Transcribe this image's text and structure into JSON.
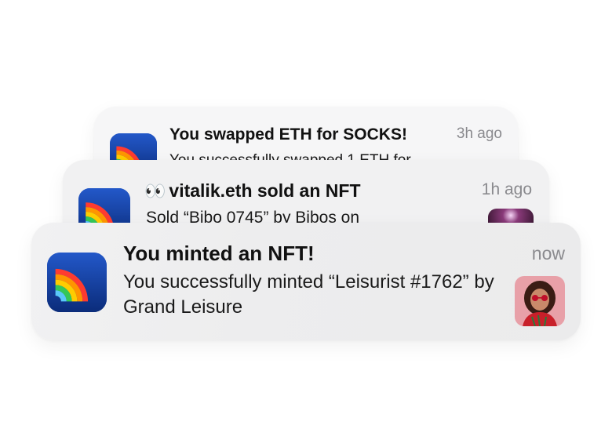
{
  "notifications": [
    {
      "title": "You swapped ETH for SOCKS!",
      "body": "You successfully swapped 1 ETH for",
      "time": "3h ago"
    },
    {
      "title_prefix_emoji": "👀",
      "title": "vitalik.eth sold an NFT",
      "body": "Sold “Bibo 0745” by Bibos on",
      "time": "1h ago",
      "thumbnail": "nft-thumbnail-dark"
    },
    {
      "title": "You minted an NFT!",
      "body": "You successfully minted “Leisurist #1762” by Grand Leisure",
      "time": "now",
      "thumbnail": "nft-thumbnail-portrait"
    }
  ],
  "app_icon": "rainbow-app-icon",
  "colors": {
    "icon_blue": "#1d4fbf",
    "time_gray": "#8a8a8e",
    "card_bg": "#f1f1f2"
  }
}
